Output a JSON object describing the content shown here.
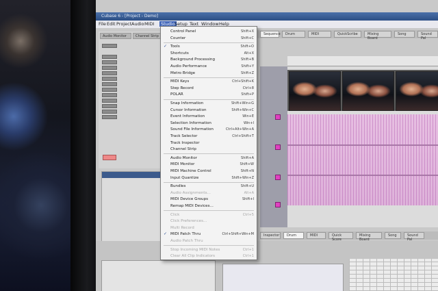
{
  "window": {
    "title": "Cubase 6 - [Project - Demo]",
    "menu": [
      "File",
      "Edit",
      "Project",
      "Audio",
      "MIDI",
      "Studio",
      "Setup",
      "Text",
      "Window",
      "Help"
    ],
    "active_menu": "Studio"
  },
  "inspector": {
    "tabs": [
      "Audio Monitor",
      "Channel Strip"
    ]
  },
  "arrange_tabs": [
    "Sequence",
    "Drum",
    "MIDI",
    "QuickScribe",
    "Mixing Board",
    "Song",
    "Sound Pal"
  ],
  "lower_tabs": [
    "Inspector",
    "Drum",
    "MIDI",
    "Quick Score",
    "Mixing Board",
    "Song",
    "Sound Pal",
    "Other"
  ],
  "studio_menu": {
    "items": [
      {
        "label": "Control Panel",
        "shortcut": "Shift+X"
      },
      {
        "label": "Counter",
        "shortcut": "Shift+C"
      },
      {
        "label": "Tools",
        "shortcut": "Shift+O",
        "checked": true
      },
      {
        "label": "Shortcuts",
        "shortcut": "Alt+X"
      },
      {
        "label": "Background Processing",
        "shortcut": "Shift+B"
      },
      {
        "label": "Audio Performance",
        "shortcut": "Shift+Y"
      },
      {
        "label": "Metro Bridge",
        "shortcut": "Shift+Z"
      },
      {
        "label": "MIDI Keys",
        "shortcut": "Ctrl+Shift+K"
      },
      {
        "label": "Step Record",
        "shortcut": "Ctrl+8"
      },
      {
        "label": "POLAR",
        "shortcut": "Shift+P"
      },
      {
        "label": "Snap Information",
        "shortcut": "Shift+Win+G"
      },
      {
        "label": "Cursor Information",
        "shortcut": "Shift+Win+C"
      },
      {
        "label": "Event Information",
        "shortcut": "Win+E"
      },
      {
        "label": "Selection Information",
        "shortcut": "Win+I"
      },
      {
        "label": "Sound File Information",
        "shortcut": "Ctrl+Alt+Win+A"
      },
      {
        "label": "Track Selector",
        "shortcut": "Ctrl+Shift+T"
      },
      {
        "label": "Track Inspector",
        "shortcut": ""
      },
      {
        "label": "Channel Strip",
        "shortcut": ""
      },
      {
        "label": "Audio Monitor",
        "shortcut": "Shift+A"
      },
      {
        "label": "MIDI Monitor",
        "shortcut": "Shift+W"
      },
      {
        "label": "MIDI Machine Control",
        "shortcut": "Shift+N"
      },
      {
        "label": "Input Quantize",
        "shortcut": "Shift+Win+Z"
      },
      {
        "label": "Bundles",
        "shortcut": "Shift+U"
      },
      {
        "label": "Audio Assignments...",
        "shortcut": "Alt+A",
        "disabled": true
      },
      {
        "label": "MIDI Device Groups",
        "shortcut": "Shift+I"
      },
      {
        "label": "Remap MIDI Devices...",
        "shortcut": ""
      },
      {
        "label": "Click",
        "shortcut": "Ctrl+5",
        "disabled": true
      },
      {
        "label": "Click Preferences...",
        "shortcut": "",
        "disabled": true
      },
      {
        "label": "Multi Record",
        "shortcut": "",
        "disabled": true
      },
      {
        "label": "MIDI Patch Thru",
        "shortcut": "Ctrl+Shift+Win+M",
        "checked": true
      },
      {
        "label": "Audio Patch Thru",
        "shortcut": "",
        "disabled": true
      },
      {
        "label": "Stop Incoming MIDI Notes",
        "shortcut": "Ctrl+1",
        "disabled": true
      },
      {
        "label": "Clear All Clip Indicators",
        "shortcut": "Ctrl+1",
        "disabled": true
      }
    ],
    "separators_after": [
      1,
      6,
      9,
      17,
      21,
      25,
      30
    ]
  },
  "colors": {
    "accent": "#3d63b8",
    "midi_region": "#e2b6dd",
    "track_marker": "#e040c0"
  }
}
